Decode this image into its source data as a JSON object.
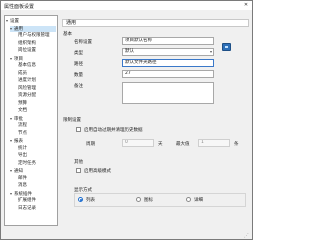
{
  "window": {
    "title": "属性面板设置",
    "close_label": "✕"
  },
  "tree": {
    "items": [
      {
        "label": "设置",
        "expander": "▾",
        "selected": false
      },
      {
        "label": "通用",
        "expander": "▾",
        "selected": true
      },
      {
        "label": "用户与权限管理",
        "expander": "",
        "selected": false
      },
      {
        "label": "组织架构",
        "expander": "",
        "selected": false
      },
      {
        "label": "岗位设置",
        "expander": "",
        "selected": false
      },
      {
        "label": "项目",
        "expander": "▾",
        "selected": false
      },
      {
        "label": "基本信息",
        "expander": "",
        "selected": false
      },
      {
        "label": "成员",
        "expander": "",
        "selected": false
      },
      {
        "label": "进度计划",
        "expander": "",
        "selected": false
      },
      {
        "label": "风险管理",
        "expander": "",
        "selected": false
      },
      {
        "label": "资源分配",
        "expander": "",
        "selected": false
      },
      {
        "label": "预算",
        "expander": "",
        "selected": false
      },
      {
        "label": "文档",
        "expander": "",
        "selected": false
      },
      {
        "label": "审批",
        "expander": "▾",
        "selected": false
      },
      {
        "label": "流程",
        "expander": "",
        "selected": false
      },
      {
        "label": "节点",
        "expander": "",
        "selected": false
      },
      {
        "label": "报表",
        "expander": "▾",
        "selected": false
      },
      {
        "label": "统计",
        "expander": "",
        "selected": false
      },
      {
        "label": "导出",
        "expander": "",
        "selected": false
      },
      {
        "label": "定时任务",
        "expander": "",
        "selected": false
      },
      {
        "label": "通知",
        "expander": "▾",
        "selected": false
      },
      {
        "label": "邮件",
        "expander": "",
        "selected": false
      },
      {
        "label": "消息",
        "expander": "",
        "selected": false
      },
      {
        "label": "系统插件",
        "expander": "▾",
        "selected": false
      },
      {
        "label": "扩展组件",
        "expander": "",
        "selected": false
      },
      {
        "label": "日志记录",
        "expander": "",
        "selected": false
      }
    ]
  },
  "panel": {
    "header": "通用",
    "basic": {
      "group_label": "基本",
      "name_label": "名称设置",
      "name_value": "项目默认名称",
      "type_label": "类型",
      "type_value": "默认",
      "path_label": "路径",
      "path_value": "默认文件夹路径",
      "count_label": "数量",
      "count_value": "27",
      "note_label": "备注"
    },
    "limits": {
      "group_label": "限制设置",
      "enable_label": "启用自动过期并清理历史数据",
      "period_label": "周期",
      "period_value": "0",
      "period_unit": "天",
      "max_label": "最大值",
      "max_value": "1",
      "max_unit": "条"
    },
    "options": {
      "group_label": "其他",
      "check_label": "启用高级模式"
    },
    "mode": {
      "group_label": "显示方式",
      "opt1": "列表",
      "opt2": "图标",
      "opt3": "详细"
    }
  }
}
